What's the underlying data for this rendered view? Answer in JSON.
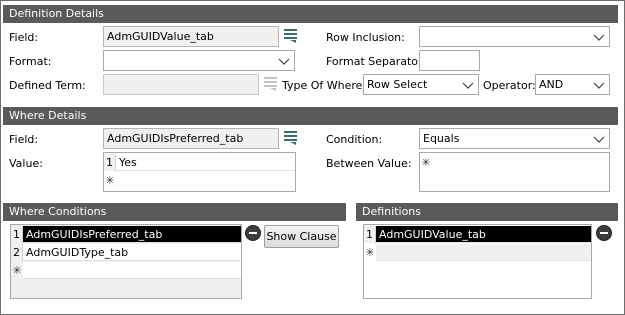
{
  "definition_details": {
    "header": "Definition Details",
    "field_label": "Field:",
    "field_value": "AdmGUIDValue_tab",
    "row_inclusion_label": "Row Inclusion:",
    "row_inclusion_value": "",
    "format_label": "Format:",
    "format_value": "",
    "format_separator_label": "Format Separator:",
    "format_separator_value": "",
    "defined_term_label": "Defined Term:",
    "defined_term_value": "",
    "type_of_where_label": "Type Of Where:",
    "type_of_where_value": "Row Select",
    "operator_label": "Operator:",
    "operator_value": "AND"
  },
  "where_details": {
    "header": "Where Details",
    "field_label": "Field:",
    "field_value": "AdmGUIDIsPreferred_tab",
    "condition_label": "Condition:",
    "condition_value": "Equals",
    "value_label": "Value:",
    "value_rows": [
      {
        "num": "1",
        "text": "Yes"
      }
    ],
    "between_value_label": "Between Value:"
  },
  "where_conditions": {
    "header": "Where Conditions",
    "rows": [
      {
        "num": "1",
        "text": "AdmGUIDIsPreferred_tab"
      },
      {
        "num": "2",
        "text": "AdmGUIDType_tab"
      }
    ],
    "show_clause_label": "Show Clause"
  },
  "definitions": {
    "header": "Definitions",
    "rows": [
      {
        "num": "1",
        "text": "AdmGUIDValue_tab"
      }
    ]
  },
  "icons": {
    "new_row_marker": "✳",
    "dropdown": "chevron-down-icon",
    "picker": "list-picker-icon",
    "remove": "remove-circle-icon"
  },
  "colors": {
    "section_header_bg": "#5a5a5a",
    "selected_row_bg": "#000000",
    "readonly_bg": "#f0f0f0"
  }
}
